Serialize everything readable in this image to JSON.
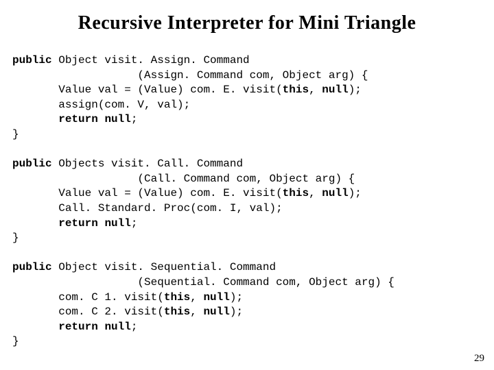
{
  "title": "Recursive Interpreter for Mini Triangle",
  "page_number": "29",
  "code": {
    "b1": {
      "kw_public": "public",
      "sig1": " Object visit. Assign. Command",
      "sig2": "                   (Assign. Command com, Object arg) {",
      "l1a": "       Value val = (Value) com. E. visit(",
      "kw_this1": "this",
      "l1b": ", ",
      "kw_null1": "null",
      "l1c": ");",
      "l2": "       assign(com. V, val);",
      "ret_indent": "       ",
      "kw_return": "return",
      "ret_sp": " ",
      "kw_null2": "null",
      "ret_end": ";",
      "close": "}"
    },
    "b2": {
      "kw_public": "public",
      "sig1": " Objects visit. Call. Command",
      "sig2": "                   (Call. Command com, Object arg) {",
      "l1a": "       Value val = (Value) com. E. visit(",
      "kw_this1": "this",
      "l1b": ", ",
      "kw_null1": "null",
      "l1c": ");",
      "l2": "       Call. Standard. Proc(com. I, val);",
      "ret_indent": "       ",
      "kw_return": "return",
      "ret_sp": " ",
      "kw_null2": "null",
      "ret_end": ";",
      "close": "}"
    },
    "b3": {
      "kw_public": "public",
      "sig1": " Object visit. Sequential. Command",
      "sig2": "                   (Sequential. Command com, Object arg) {",
      "l1a": "       com. C 1. visit(",
      "kw_this1": "this",
      "l1b": ", ",
      "kw_null1": "null",
      "l1c": ");",
      "l2a": "       com. C 2. visit(",
      "kw_this2": "this",
      "l2b": ", ",
      "kw_null2": "null",
      "l2c": ");",
      "ret_indent": "       ",
      "kw_return": "return",
      "ret_sp": " ",
      "kw_null3": "null",
      "ret_end": ";",
      "close": "}"
    }
  }
}
